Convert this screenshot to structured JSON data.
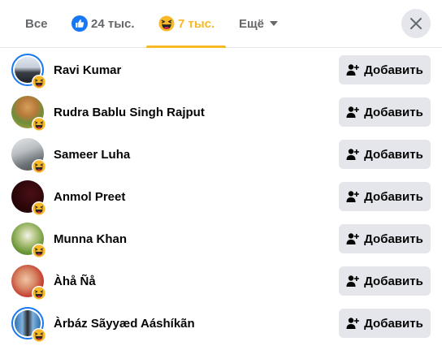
{
  "tabs": {
    "all_label": "Все",
    "like_count": "24 тыс.",
    "haha_count": "7 тыс.",
    "more_label": "Ещё"
  },
  "colors": {
    "accent_haha": "#f7b928",
    "like_blue": "#1877f2",
    "button_bg": "#e4e6eb"
  },
  "icons": {
    "like": "thumbs-up-icon",
    "haha": "laughing-face-icon",
    "close": "close-icon",
    "add_friend": "add-friend-icon"
  },
  "people": [
    {
      "name": "Ravi Kumar",
      "button_label": "Добавить"
    },
    {
      "name": "Rudra Bablu Singh Rajput",
      "button_label": "Добавить"
    },
    {
      "name": "Sameer Luha",
      "button_label": "Добавить"
    },
    {
      "name": "Anmol Preet",
      "button_label": "Добавить"
    },
    {
      "name": "Munna Khan",
      "button_label": "Добавить"
    },
    {
      "name": "Àhå Ñå",
      "button_label": "Добавить"
    },
    {
      "name": "Àrbáz Sãyyæd Aáshíkãn",
      "button_label": "Добавить"
    }
  ]
}
